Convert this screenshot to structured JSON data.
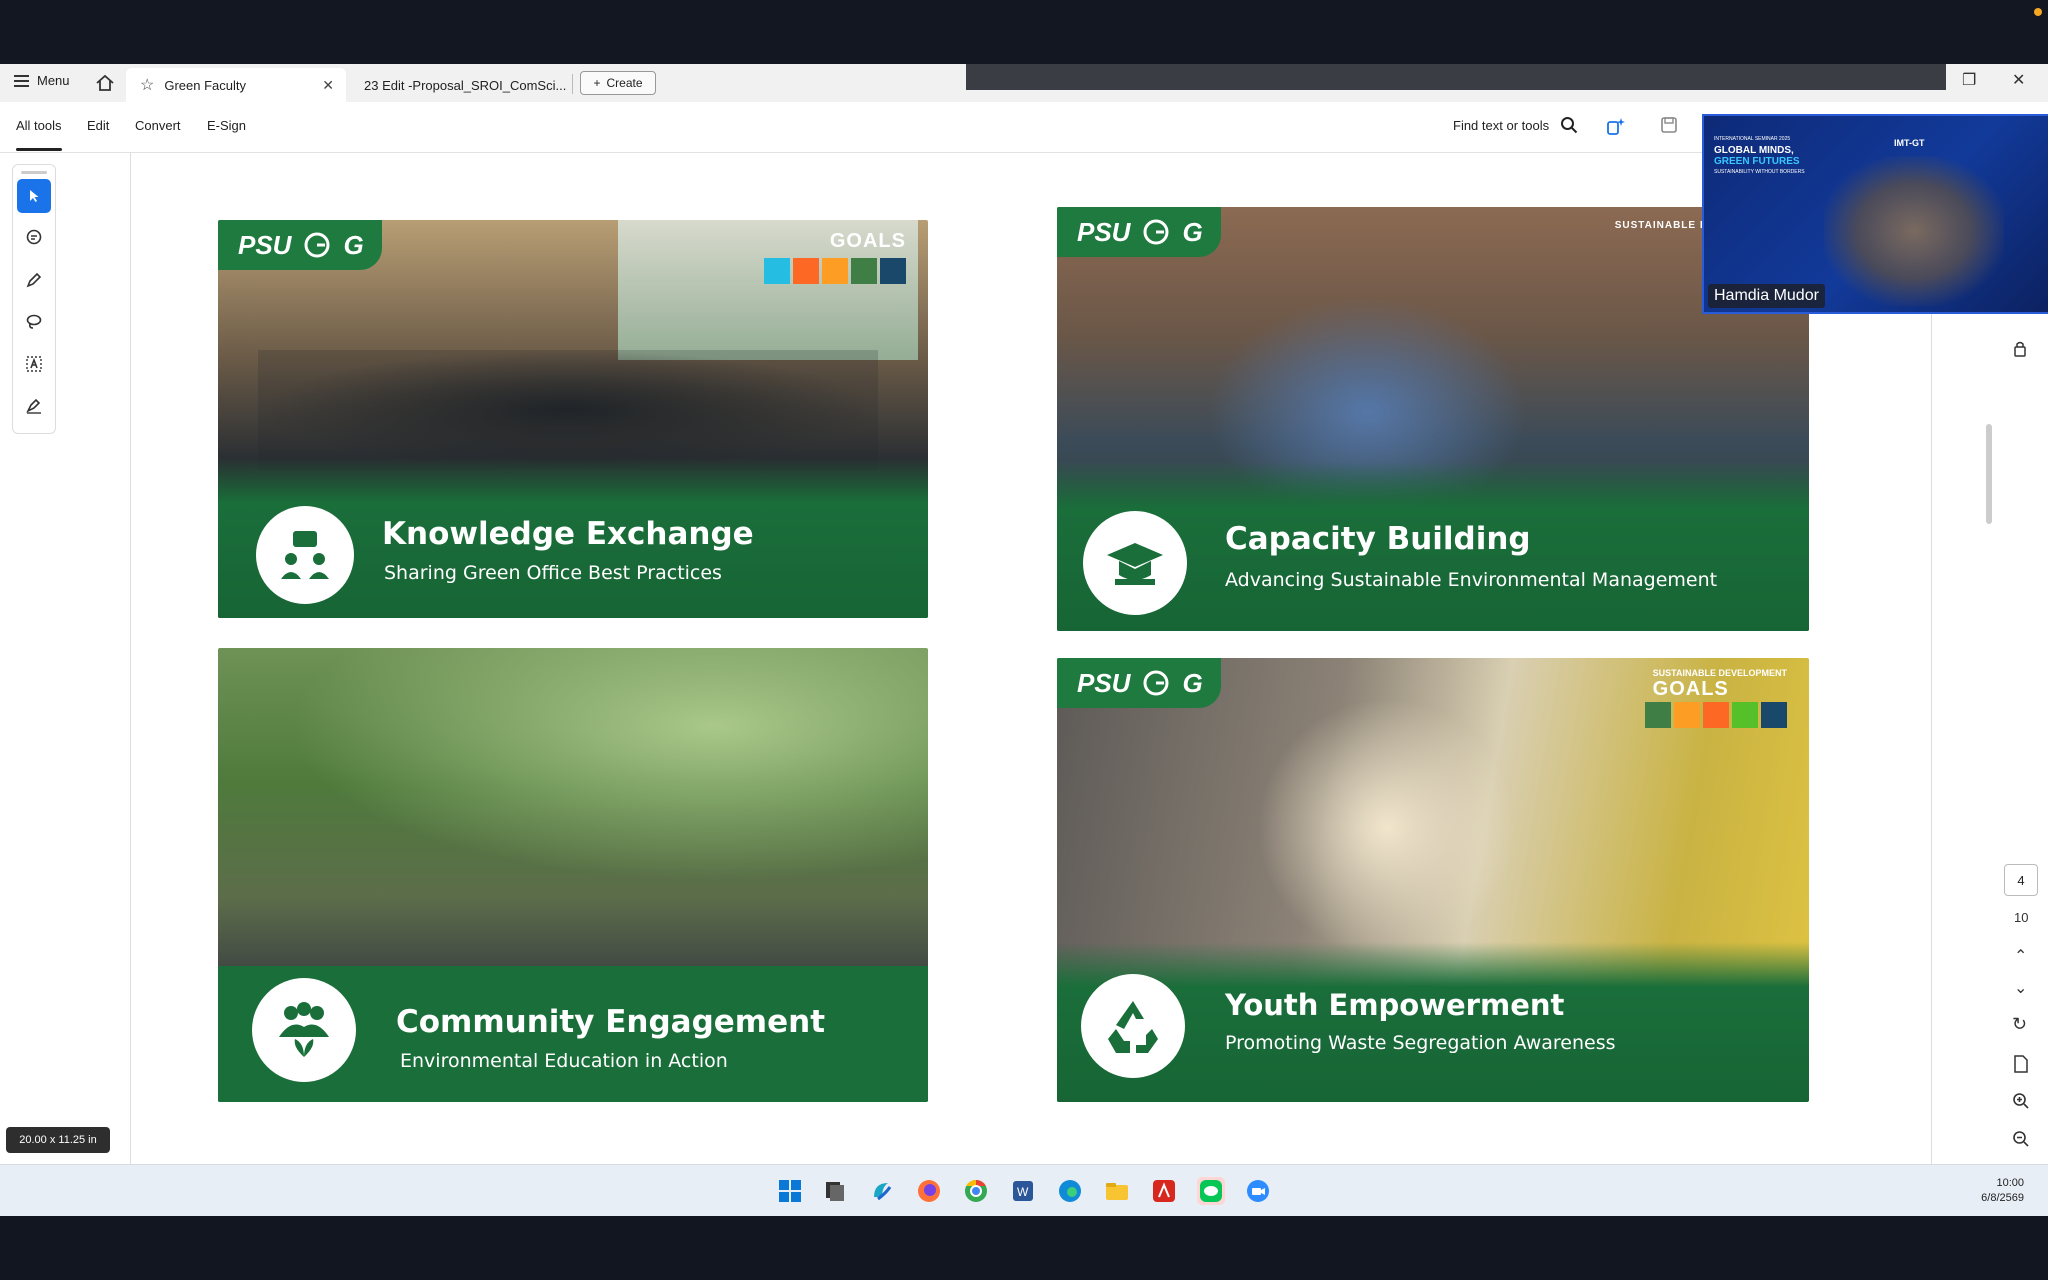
{
  "tabbar": {
    "menu_label": "Menu",
    "tabs": [
      {
        "label": "Green Faculty",
        "active": true
      },
      {
        "label": "23 Edit -Proposal_SROI_ComSci..."
      }
    ],
    "create_label": "Create"
  },
  "toolbar": {
    "items": [
      "All tools",
      "Edit",
      "Convert",
      "E-Sign"
    ],
    "find_label": "Find text or tools"
  },
  "doc": {
    "size_badge": "20.00 x 11.25 in",
    "panels": [
      {
        "title": "Knowledge Exchange",
        "subtitle": "Sharing Green Office Best Practices",
        "goals": "GOALS",
        "logo": "PSU"
      },
      {
        "title": "Capacity Building",
        "subtitle": "Advancing Sustainable Environmental Management",
        "goals_small": "SUSTAINABLE DEVELOPMENT",
        "logo": "PSU"
      },
      {
        "title": "Community Engagement",
        "subtitle": "Environmental Education in Action"
      },
      {
        "title": "Youth Empowerment",
        "subtitle": "Promoting Waste Segregation Awareness",
        "goals": "GOALS",
        "goals_small": "SUSTAINABLE DEVELOPMENT",
        "logo": "PSU"
      }
    ]
  },
  "page_nav": {
    "current": "4",
    "total": "10"
  },
  "video": {
    "participant": "Hamdia Mudor",
    "headline_small": "INTERNATIONAL SEMINAR 2025",
    "headline_1": "GLOBAL MINDS,",
    "headline_2": "GREEN FUTURES",
    "headline_tag": "SUSTAINABILITY WITHOUT BORDERS",
    "brand": "IMT-GT"
  },
  "taskbar": {
    "time": "10:00",
    "date": "6/8/2569"
  },
  "colors": {
    "panel_green": "#1a6e3a",
    "accent_blue": "#1a73e8"
  }
}
